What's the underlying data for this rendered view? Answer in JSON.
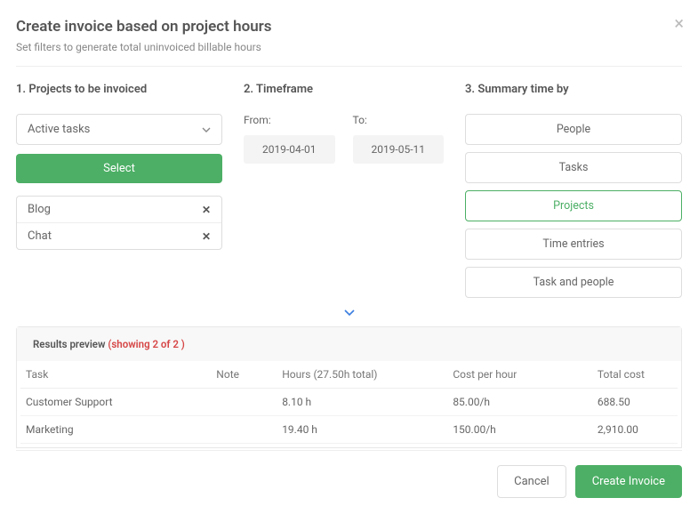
{
  "header": {
    "title": "Create invoice based on project hours",
    "subtitle": "Set filters to generate total uninvoiced billable hours"
  },
  "sections": {
    "projects": {
      "title": "1. Projects to be invoiced",
      "dropdown": "Active tasks",
      "select_label": "Select",
      "items": [
        "Blog",
        "Chat"
      ]
    },
    "timeframe": {
      "title": "2. Timeframe",
      "from_label": "From:",
      "to_label": "To:",
      "from_value": "2019-04-01",
      "to_value": "2019-05-11"
    },
    "summary": {
      "title": "3. Summary time by",
      "options": [
        "People",
        "Tasks",
        "Projects",
        "Time entries",
        "Task and people"
      ],
      "active_index": 2
    }
  },
  "results": {
    "label": "Results preview ",
    "count": "(showing 2 of 2 )",
    "columns": {
      "task": "Task",
      "note": "Note",
      "hours": "Hours (27.50h total)",
      "cost": "Cost per hour",
      "total": "Total cost"
    },
    "rows": [
      {
        "task": "Customer Support",
        "note": "",
        "hours": "8.10 h",
        "cost": "85.00/h",
        "total": "688.50"
      },
      {
        "task": "Marketing",
        "note": "",
        "hours": "19.40 h",
        "cost": "150.00/h",
        "total": "2,910.00"
      }
    ]
  },
  "footer": {
    "cancel": "Cancel",
    "create": "Create Invoice"
  },
  "chart_data": {
    "type": "table",
    "columns": [
      "Task",
      "Note",
      "Hours",
      "Cost per hour",
      "Total cost"
    ],
    "rows": [
      [
        "Customer Support",
        "",
        "8.10 h",
        "85.00/h",
        "688.50"
      ],
      [
        "Marketing",
        "",
        "19.40 h",
        "150.00/h",
        "2,910.00"
      ]
    ],
    "total_hours": 27.5
  }
}
